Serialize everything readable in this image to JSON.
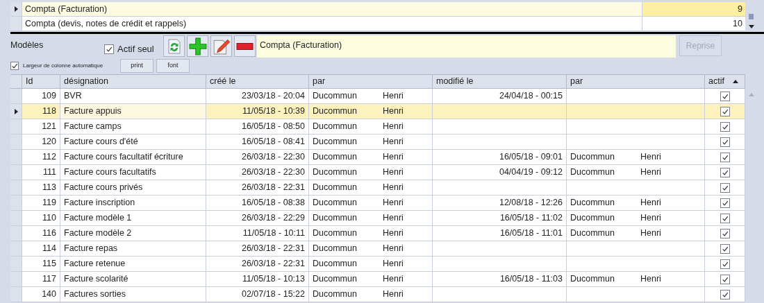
{
  "top_grid": {
    "rows": [
      {
        "label": "Compta (Facturation)",
        "value": "9",
        "selected": true
      },
      {
        "label": "Compta (devis, notes de crédit et rappels)",
        "value": "10",
        "selected": false
      }
    ]
  },
  "toolbar": {
    "title": "Modèles",
    "active_only": {
      "label": "Actif seul",
      "checked": true
    },
    "current_model": "Compta (Facturation)",
    "reprise_button": {
      "label": "Reprise",
      "disabled": true
    }
  },
  "options": {
    "auto_width": {
      "label": "Largeur de colonne automatique",
      "checked": true
    },
    "buttons": [
      "print",
      "font"
    ]
  },
  "table": {
    "columns": [
      {
        "label": "Id"
      },
      {
        "label": "désignation"
      },
      {
        "label": "créé le"
      },
      {
        "label": "par"
      },
      {
        "label": "modifié le"
      },
      {
        "label": "par"
      },
      {
        "label": "actif",
        "sorted_ascending": true
      }
    ],
    "rows": [
      {
        "id": "109",
        "designation": "BVR",
        "created": "23/03/18 - 20:04",
        "created_by": [
          "Ducommun",
          "Henri"
        ],
        "modified": "24/04/18 - 00:15",
        "active": true,
        "selected": false
      },
      {
        "id": "118",
        "designation": "Facture appuis",
        "created": "11/05/18 - 10:39",
        "created_by": [
          "Ducommun",
          "Henri"
        ],
        "active": true,
        "selected": true
      },
      {
        "id": "121",
        "designation": "Facture camps",
        "created": "16/05/18 - 08:50",
        "created_by": [
          "Ducommun",
          "Henri"
        ],
        "active": true,
        "selected": false
      },
      {
        "id": "120",
        "designation": "Facture cours d'été",
        "created": "16/05/18 - 08:41",
        "created_by": [
          "Ducommun",
          "Henri"
        ],
        "active": true,
        "selected": false
      },
      {
        "id": "112",
        "designation": "Facture cours facultatif écriture",
        "created": "26/03/18 - 22:30",
        "created_by": [
          "Ducommun",
          "Henri"
        ],
        "modified": "16/05/18 - 09:01",
        "modified_by": [
          "Ducommun",
          "Henri"
        ],
        "active": true,
        "selected": false
      },
      {
        "id": "111",
        "designation": "Facture cours facultatifs",
        "created": "26/03/18 - 22:30",
        "created_by": [
          "Ducommun",
          "Henri"
        ],
        "modified": "04/04/19 - 09:12",
        "modified_by": [
          "Ducommun",
          "Henri"
        ],
        "active": true,
        "selected": false
      },
      {
        "id": "113",
        "designation": "Facture cours privés",
        "created": "26/03/18 - 22:31",
        "created_by": [
          "Ducommun",
          "Henri"
        ],
        "active": true,
        "selected": false
      },
      {
        "id": "119",
        "designation": "Facture inscription",
        "created": "16/05/18 - 08:38",
        "created_by": [
          "Ducommun",
          "Henri"
        ],
        "modified": "12/08/18 - 12:26",
        "modified_by": [
          "Ducommun",
          "Henri"
        ],
        "active": true,
        "selected": false
      },
      {
        "id": "110",
        "designation": "Facture modèle 1",
        "created": "26/03/18 - 22:29",
        "created_by": [
          "Ducommun",
          "Henri"
        ],
        "modified": "16/05/18 - 11:02",
        "modified_by": [
          "Ducommun",
          "Henri"
        ],
        "active": true,
        "selected": false
      },
      {
        "id": "116",
        "designation": "Facture modèle 2",
        "created": "11/05/18 - 10:11",
        "created_by": [
          "Ducommun",
          "Henri"
        ],
        "modified": "16/05/18 - 11:01",
        "modified_by": [
          "Ducommun",
          "Henri"
        ],
        "active": true,
        "selected": false
      },
      {
        "id": "114",
        "designation": "Facture repas",
        "created": "26/03/18 - 22:31",
        "created_by": [
          "Ducommun",
          "Henri"
        ],
        "active": true,
        "selected": false
      },
      {
        "id": "115",
        "designation": "Facture retenue",
        "created": "26/03/18 - 22:31",
        "created_by": [
          "Ducommun",
          "Henri"
        ],
        "active": true,
        "selected": false
      },
      {
        "id": "117",
        "designation": "Facture scolarité",
        "created": "11/05/18 - 10:13",
        "created_by": [
          "Ducommun",
          "Henri"
        ],
        "modified": "16/05/18 - 11:03",
        "modified_by": [
          "Ducommun",
          "Henri"
        ],
        "active": true,
        "selected": false
      },
      {
        "id": "140",
        "designation": "Factures sorties",
        "created": "02/07/18 - 15:22",
        "created_by": [
          "Ducommun",
          "Henri"
        ],
        "active": true,
        "selected": false
      }
    ]
  }
}
